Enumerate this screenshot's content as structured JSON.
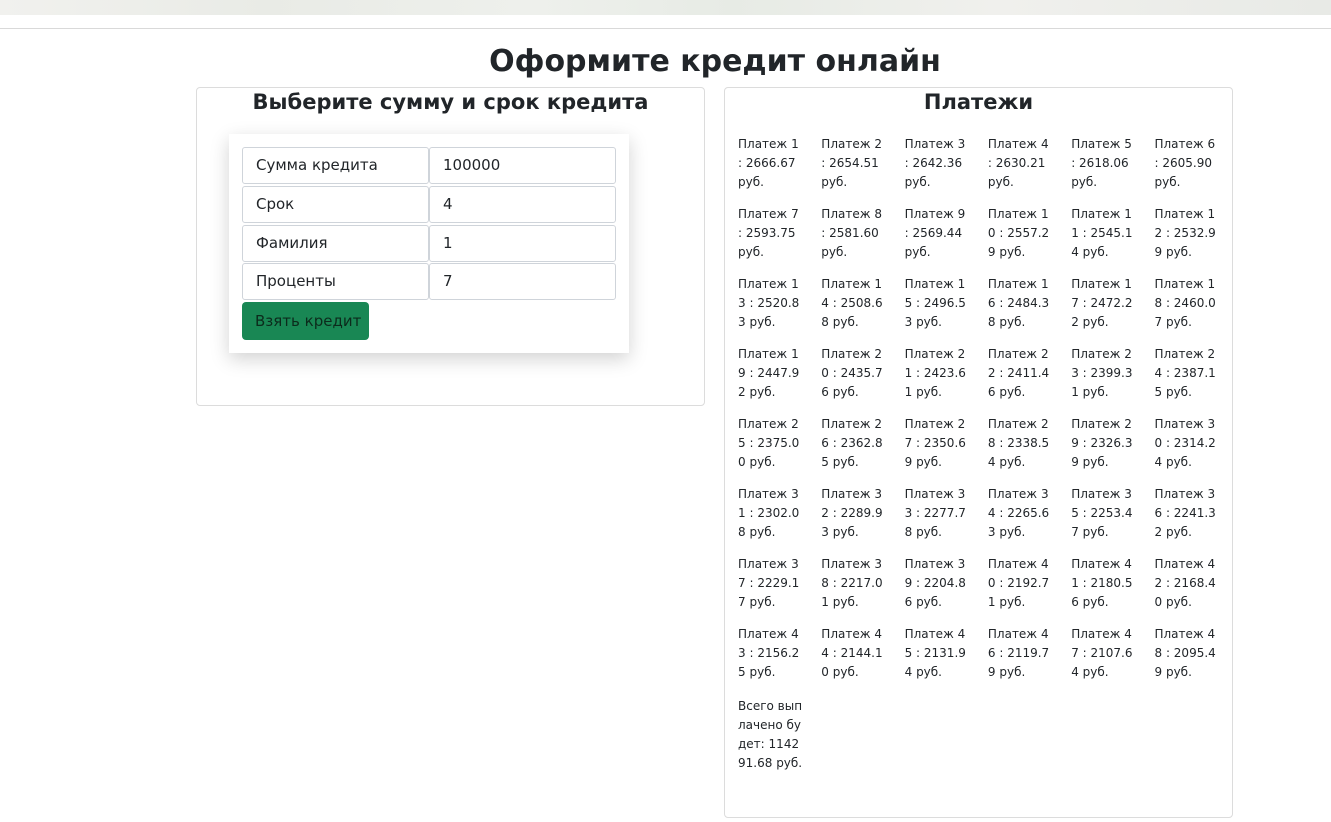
{
  "page": {
    "title": "Оформите кредит онлайн"
  },
  "form_card": {
    "title": "Выберите сумму и срок кредита",
    "rows": [
      {
        "label": "Сумма кредита",
        "value": "100000"
      },
      {
        "label": "Срок",
        "value": "4"
      },
      {
        "label": "Фамилия",
        "value": "1"
      },
      {
        "label": "Проценты",
        "value": "7"
      }
    ],
    "submit_label": "Взять кредит"
  },
  "payments_card": {
    "title": "Платежи",
    "currency": "руб.",
    "payments": [
      {
        "n": "1",
        "amount": "2666.67"
      },
      {
        "n": "2",
        "amount": "2654.51"
      },
      {
        "n": "3",
        "amount": "2642.36"
      },
      {
        "n": "4",
        "amount": "2630.21"
      },
      {
        "n": "5",
        "amount": "2618.06"
      },
      {
        "n": "6",
        "amount": "2605.90"
      },
      {
        "n": "7",
        "amount": "2593.75"
      },
      {
        "n": "8",
        "amount": "2581.60"
      },
      {
        "n": "9",
        "amount": "2569.44"
      },
      {
        "n": "10",
        "amount": "2557.29"
      },
      {
        "n": "11",
        "amount": "2545.14"
      },
      {
        "n": "12",
        "amount": "2532.99"
      },
      {
        "n": "13",
        "amount": "2520.83"
      },
      {
        "n": "14",
        "amount": "2508.68"
      },
      {
        "n": "15",
        "amount": "2496.53"
      },
      {
        "n": "16",
        "amount": "2484.38"
      },
      {
        "n": "17",
        "amount": "2472.22"
      },
      {
        "n": "18",
        "amount": "2460.07"
      },
      {
        "n": "19",
        "amount": "2447.92"
      },
      {
        "n": "20",
        "amount": "2435.76"
      },
      {
        "n": "21",
        "amount": "2423.61"
      },
      {
        "n": "22",
        "amount": "2411.46"
      },
      {
        "n": "23",
        "amount": "2399.31"
      },
      {
        "n": "24",
        "amount": "2387.15"
      },
      {
        "n": "25",
        "amount": "2375.00"
      },
      {
        "n": "26",
        "amount": "2362.85"
      },
      {
        "n": "27",
        "amount": "2350.69"
      },
      {
        "n": "28",
        "amount": "2338.54"
      },
      {
        "n": "29",
        "amount": "2326.39"
      },
      {
        "n": "30",
        "amount": "2314.24"
      },
      {
        "n": "31",
        "amount": "2302.08"
      },
      {
        "n": "32",
        "amount": "2289.93"
      },
      {
        "n": "33",
        "amount": "2277.78"
      },
      {
        "n": "34",
        "amount": "2265.63"
      },
      {
        "n": "35",
        "amount": "2253.47"
      },
      {
        "n": "36",
        "amount": "2241.32"
      },
      {
        "n": "37",
        "amount": "2229.17"
      },
      {
        "n": "38",
        "amount": "2217.01"
      },
      {
        "n": "39",
        "amount": "2204.86"
      },
      {
        "n": "40",
        "amount": "2192.71"
      },
      {
        "n": "41",
        "amount": "2180.56"
      },
      {
        "n": "42",
        "amount": "2168.40"
      },
      {
        "n": "43",
        "amount": "2156.25"
      },
      {
        "n": "44",
        "amount": "2144.10"
      },
      {
        "n": "45",
        "amount": "2131.94"
      },
      {
        "n": "46",
        "amount": "2119.79"
      },
      {
        "n": "47",
        "amount": "2107.64"
      },
      {
        "n": "48",
        "amount": "2095.49"
      }
    ],
    "payment_word": "Платеж",
    "total": {
      "label": "Всего выплачено будет:",
      "amount": "114291.68"
    }
  },
  "colors": {
    "accent_button": "#198754"
  }
}
